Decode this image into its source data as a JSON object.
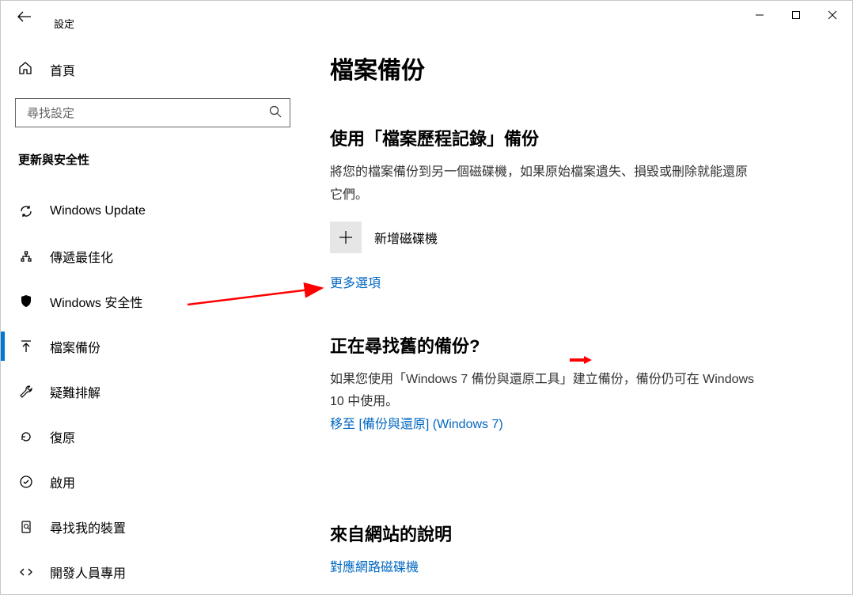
{
  "window": {
    "app_title": "設定"
  },
  "sidebar": {
    "home_label": "首頁",
    "search_placeholder": "尋找設定",
    "section_header": "更新與安全性",
    "items": [
      {
        "label": "Windows Update"
      },
      {
        "label": "傳遞最佳化"
      },
      {
        "label": "Windows 安全性"
      },
      {
        "label": "檔案備份"
      },
      {
        "label": "疑難排解"
      },
      {
        "label": "復原"
      },
      {
        "label": "啟用"
      },
      {
        "label": "尋找我的裝置"
      },
      {
        "label": "開發人員專用"
      }
    ],
    "active_index": 3
  },
  "content": {
    "page_title": "檔案備份",
    "section1": {
      "heading": "使用「檔案歷程記錄」備份",
      "desc": "將您的檔案備份到另一個磁碟機，如果原始檔案遺失、損毀或刪除就能還原它們。",
      "add_drive_label": "新增磁碟機",
      "more_options": "更多選項"
    },
    "section2": {
      "heading": "正在尋找舊的備份?",
      "desc": "如果您使用「Windows 7 備份與還原工具」建立備份，備份仍可在 Windows 10 中使用。",
      "link": "移至 [備份與還原] (Windows 7)"
    },
    "section3": {
      "heading": "來自網站的說明",
      "link": "對應網路磁碟機"
    }
  }
}
